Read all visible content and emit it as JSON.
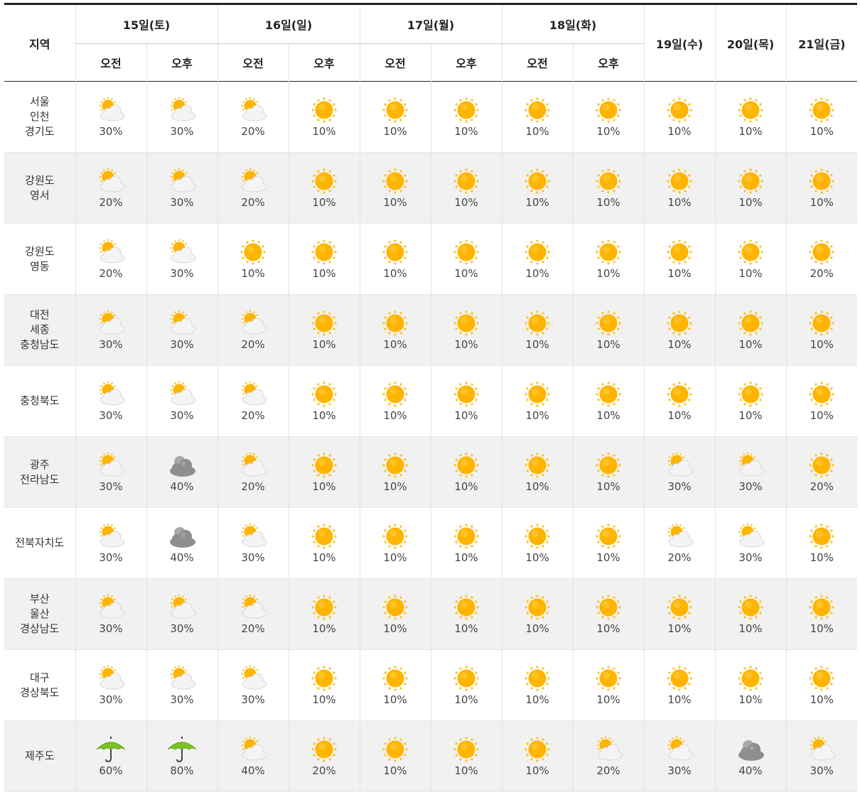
{
  "header": {
    "region_label": "지역",
    "split_days": [
      {
        "label": "15일(토)"
      },
      {
        "label": "16일(일)"
      },
      {
        "label": "17일(월)"
      },
      {
        "label": "18일(화)"
      }
    ],
    "am_label": "오전",
    "pm_label": "오후",
    "single_days": [
      {
        "label": "19일(수)"
      },
      {
        "label": "20일(목)"
      },
      {
        "label": "21일(금)"
      }
    ]
  },
  "rows": [
    {
      "region": [
        "서울",
        "인천",
        "경기도"
      ],
      "cells": [
        {
          "icon": "partly-cloudy-icon",
          "pct": "30%"
        },
        {
          "icon": "partly-cloudy-icon",
          "pct": "30%"
        },
        {
          "icon": "partly-cloudy-icon",
          "pct": "20%"
        },
        {
          "icon": "sun-icon",
          "pct": "10%"
        },
        {
          "icon": "sun-icon",
          "pct": "10%"
        },
        {
          "icon": "sun-icon",
          "pct": "10%"
        },
        {
          "icon": "sun-icon",
          "pct": "10%"
        },
        {
          "icon": "sun-icon",
          "pct": "10%"
        },
        {
          "icon": "sun-icon",
          "pct": "10%"
        },
        {
          "icon": "sun-icon",
          "pct": "10%"
        },
        {
          "icon": "sun-icon",
          "pct": "10%"
        }
      ]
    },
    {
      "region": [
        "강원도",
        "영서"
      ],
      "cells": [
        {
          "icon": "partly-cloudy-icon",
          "pct": "20%"
        },
        {
          "icon": "partly-cloudy-icon",
          "pct": "30%"
        },
        {
          "icon": "partly-cloudy-icon",
          "pct": "20%"
        },
        {
          "icon": "sun-icon",
          "pct": "10%"
        },
        {
          "icon": "sun-icon",
          "pct": "10%"
        },
        {
          "icon": "sun-icon",
          "pct": "10%"
        },
        {
          "icon": "sun-icon",
          "pct": "10%"
        },
        {
          "icon": "sun-icon",
          "pct": "10%"
        },
        {
          "icon": "sun-icon",
          "pct": "10%"
        },
        {
          "icon": "sun-icon",
          "pct": "10%"
        },
        {
          "icon": "sun-icon",
          "pct": "10%"
        }
      ]
    },
    {
      "region": [
        "강원도",
        "영동"
      ],
      "cells": [
        {
          "icon": "partly-cloudy-icon",
          "pct": "20%"
        },
        {
          "icon": "partly-cloudy-icon",
          "pct": "30%"
        },
        {
          "icon": "sun-icon",
          "pct": "10%"
        },
        {
          "icon": "sun-icon",
          "pct": "10%"
        },
        {
          "icon": "sun-icon",
          "pct": "10%"
        },
        {
          "icon": "sun-icon",
          "pct": "10%"
        },
        {
          "icon": "sun-icon",
          "pct": "10%"
        },
        {
          "icon": "sun-icon",
          "pct": "10%"
        },
        {
          "icon": "sun-icon",
          "pct": "10%"
        },
        {
          "icon": "sun-icon",
          "pct": "10%"
        },
        {
          "icon": "sun-icon",
          "pct": "20%"
        }
      ]
    },
    {
      "region": [
        "대전",
        "세종",
        "충청남도"
      ],
      "cells": [
        {
          "icon": "partly-cloudy-icon",
          "pct": "30%"
        },
        {
          "icon": "partly-cloudy-icon",
          "pct": "30%"
        },
        {
          "icon": "partly-cloudy-icon",
          "pct": "20%"
        },
        {
          "icon": "sun-icon",
          "pct": "10%"
        },
        {
          "icon": "sun-icon",
          "pct": "10%"
        },
        {
          "icon": "sun-icon",
          "pct": "10%"
        },
        {
          "icon": "sun-icon",
          "pct": "10%"
        },
        {
          "icon": "sun-icon",
          "pct": "10%"
        },
        {
          "icon": "sun-icon",
          "pct": "10%"
        },
        {
          "icon": "sun-icon",
          "pct": "10%"
        },
        {
          "icon": "sun-icon",
          "pct": "10%"
        }
      ]
    },
    {
      "region": [
        "충청북도"
      ],
      "cells": [
        {
          "icon": "partly-cloudy-icon",
          "pct": "30%"
        },
        {
          "icon": "partly-cloudy-icon",
          "pct": "30%"
        },
        {
          "icon": "partly-cloudy-icon",
          "pct": "20%"
        },
        {
          "icon": "sun-icon",
          "pct": "10%"
        },
        {
          "icon": "sun-icon",
          "pct": "10%"
        },
        {
          "icon": "sun-icon",
          "pct": "10%"
        },
        {
          "icon": "sun-icon",
          "pct": "10%"
        },
        {
          "icon": "sun-icon",
          "pct": "10%"
        },
        {
          "icon": "sun-icon",
          "pct": "10%"
        },
        {
          "icon": "sun-icon",
          "pct": "10%"
        },
        {
          "icon": "sun-icon",
          "pct": "10%"
        }
      ]
    },
    {
      "region": [
        "광주",
        "전라남도"
      ],
      "cells": [
        {
          "icon": "partly-cloudy-icon",
          "pct": "30%"
        },
        {
          "icon": "cloudy-icon",
          "pct": "40%"
        },
        {
          "icon": "partly-cloudy-icon",
          "pct": "20%"
        },
        {
          "icon": "sun-icon",
          "pct": "10%"
        },
        {
          "icon": "sun-icon",
          "pct": "10%"
        },
        {
          "icon": "sun-icon",
          "pct": "10%"
        },
        {
          "icon": "sun-icon",
          "pct": "10%"
        },
        {
          "icon": "sun-icon",
          "pct": "10%"
        },
        {
          "icon": "partly-cloudy-icon",
          "pct": "30%"
        },
        {
          "icon": "partly-cloudy-icon",
          "pct": "30%"
        },
        {
          "icon": "sun-icon",
          "pct": "20%"
        }
      ]
    },
    {
      "region": [
        "전북자치도"
      ],
      "cells": [
        {
          "icon": "partly-cloudy-icon",
          "pct": "30%"
        },
        {
          "icon": "cloudy-icon",
          "pct": "40%"
        },
        {
          "icon": "partly-cloudy-icon",
          "pct": "30%"
        },
        {
          "icon": "sun-icon",
          "pct": "10%"
        },
        {
          "icon": "sun-icon",
          "pct": "10%"
        },
        {
          "icon": "sun-icon",
          "pct": "10%"
        },
        {
          "icon": "sun-icon",
          "pct": "10%"
        },
        {
          "icon": "sun-icon",
          "pct": "10%"
        },
        {
          "icon": "partly-cloudy-icon",
          "pct": "20%"
        },
        {
          "icon": "partly-cloudy-icon",
          "pct": "30%"
        },
        {
          "icon": "sun-icon",
          "pct": "10%"
        }
      ]
    },
    {
      "region": [
        "부산",
        "울산",
        "경상남도"
      ],
      "cells": [
        {
          "icon": "partly-cloudy-icon",
          "pct": "30%"
        },
        {
          "icon": "partly-cloudy-icon",
          "pct": "30%"
        },
        {
          "icon": "partly-cloudy-icon",
          "pct": "20%"
        },
        {
          "icon": "sun-icon",
          "pct": "10%"
        },
        {
          "icon": "sun-icon",
          "pct": "10%"
        },
        {
          "icon": "sun-icon",
          "pct": "10%"
        },
        {
          "icon": "sun-icon",
          "pct": "10%"
        },
        {
          "icon": "sun-icon",
          "pct": "10%"
        },
        {
          "icon": "sun-icon",
          "pct": "10%"
        },
        {
          "icon": "sun-icon",
          "pct": "10%"
        },
        {
          "icon": "sun-icon",
          "pct": "10%"
        }
      ]
    },
    {
      "region": [
        "대구",
        "경상북도"
      ],
      "cells": [
        {
          "icon": "partly-cloudy-icon",
          "pct": "30%"
        },
        {
          "icon": "partly-cloudy-icon",
          "pct": "30%"
        },
        {
          "icon": "partly-cloudy-icon",
          "pct": "30%"
        },
        {
          "icon": "sun-icon",
          "pct": "10%"
        },
        {
          "icon": "sun-icon",
          "pct": "10%"
        },
        {
          "icon": "sun-icon",
          "pct": "10%"
        },
        {
          "icon": "sun-icon",
          "pct": "10%"
        },
        {
          "icon": "sun-icon",
          "pct": "10%"
        },
        {
          "icon": "sun-icon",
          "pct": "10%"
        },
        {
          "icon": "sun-icon",
          "pct": "10%"
        },
        {
          "icon": "sun-icon",
          "pct": "10%"
        }
      ]
    },
    {
      "region": [
        "제주도"
      ],
      "cells": [
        {
          "icon": "umbrella-icon",
          "pct": "60%"
        },
        {
          "icon": "umbrella-icon",
          "pct": "80%"
        },
        {
          "icon": "partly-cloudy-icon",
          "pct": "40%"
        },
        {
          "icon": "sun-icon",
          "pct": "20%"
        },
        {
          "icon": "sun-icon",
          "pct": "10%"
        },
        {
          "icon": "sun-icon",
          "pct": "10%"
        },
        {
          "icon": "sun-icon",
          "pct": "10%"
        },
        {
          "icon": "partly-cloudy-icon",
          "pct": "20%"
        },
        {
          "icon": "partly-cloudy-icon",
          "pct": "30%"
        },
        {
          "icon": "cloudy-icon",
          "pct": "40%"
        },
        {
          "icon": "partly-cloudy-icon",
          "pct": "30%"
        }
      ]
    }
  ],
  "colors": {
    "sun": "#ffb400",
    "sun_ray": "#ffc21a",
    "cloud": "#f4f4f4",
    "dark_cloud": "#8e8e8e",
    "umbrella": "#7cc520",
    "row_alt_bg": "#f1f1f1"
  }
}
